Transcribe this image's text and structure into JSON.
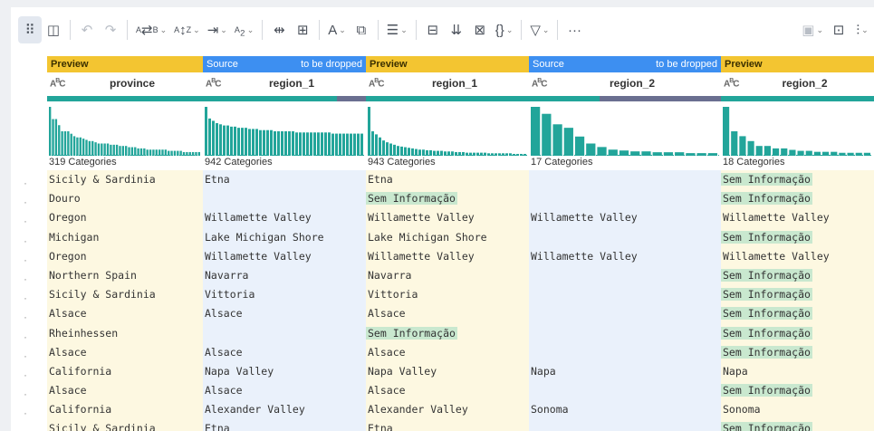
{
  "toolbar": {
    "items": [
      {
        "name": "grid-view-icon",
        "glyph": "⠿",
        "active": true
      },
      {
        "name": "column-view-icon",
        "glyph": "◫"
      },
      {
        "name": "undo-icon",
        "glyph": "↶",
        "dim": true
      },
      {
        "name": "redo-icon",
        "glyph": "↷",
        "dim": true
      }
    ]
  },
  "columns": [
    {
      "tag": "Preview",
      "tag_note": "",
      "tag_type": "preview",
      "type": "ABC",
      "name": "province",
      "categories": "319 Categories",
      "quality_missing": [],
      "histogram": [
        4,
        3,
        3,
        2.5,
        2,
        2,
        2,
        1.8,
        1.6,
        1.5,
        1.5,
        1.4,
        1.3,
        1.2,
        1.2,
        1.1,
        1,
        1,
        1,
        1,
        0.9,
        0.9,
        0.9,
        0.8,
        0.8,
        0.8,
        0.7,
        0.7,
        0.7,
        0.6,
        0.6,
        0.6,
        0.5,
        0.5,
        0.5,
        0.5,
        0.5,
        0.5,
        0.5,
        0.4,
        0.4,
        0.4,
        0.4,
        0.4,
        0.3,
        0.3,
        0.3,
        0.3,
        0.3,
        0.3
      ],
      "bg": "yellow",
      "cells": [
        {
          "v": "Sicily & Sardinia",
          "hl": false
        },
        {
          "v": "Douro",
          "hl": false
        },
        {
          "v": "Oregon",
          "hl": false
        },
        {
          "v": "Michigan",
          "hl": false
        },
        {
          "v": "Oregon",
          "hl": false
        },
        {
          "v": "Northern Spain",
          "hl": false
        },
        {
          "v": "Sicily & Sardinia",
          "hl": false
        },
        {
          "v": "Alsace",
          "hl": false
        },
        {
          "v": "Rheinhessen",
          "hl": false
        },
        {
          "v": "Alsace",
          "hl": false
        },
        {
          "v": "California",
          "hl": false
        },
        {
          "v": "Alsace",
          "hl": false
        },
        {
          "v": "California",
          "hl": false
        },
        {
          "v": "Sicily & Sardinia",
          "hl": false
        }
      ]
    },
    {
      "tag": "Source",
      "tag_note": "to be dropped",
      "tag_type": "source",
      "type": "ABC",
      "name": "region_1",
      "categories": "942 Categories",
      "quality_missing": [
        0.82,
        1.0
      ],
      "histogram": [
        42,
        32,
        30,
        28,
        27,
        26,
        26,
        25,
        25,
        24,
        24,
        24,
        23,
        23,
        23,
        22,
        22,
        22,
        22,
        21,
        21,
        21,
        21,
        21,
        21,
        20,
        20,
        20,
        20,
        20,
        20,
        20,
        20,
        20,
        20,
        19,
        19,
        19,
        19,
        19,
        19,
        19,
        19,
        19
      ],
      "bg": "blue",
      "cells": [
        {
          "v": "Etna",
          "hl": false
        },
        {
          "v": "",
          "hl": false
        },
        {
          "v": "Willamette Valley",
          "hl": false
        },
        {
          "v": "Lake Michigan Shore",
          "hl": false
        },
        {
          "v": "Willamette Valley",
          "hl": false
        },
        {
          "v": "Navarra",
          "hl": false
        },
        {
          "v": "Vittoria",
          "hl": false
        },
        {
          "v": "Alsace",
          "hl": false
        },
        {
          "v": "",
          "hl": false
        },
        {
          "v": "Alsace",
          "hl": false
        },
        {
          "v": "Napa Valley",
          "hl": false
        },
        {
          "v": "Alsace",
          "hl": false
        },
        {
          "v": "Alexander Valley",
          "hl": false
        },
        {
          "v": "Etna",
          "hl": false
        }
      ]
    },
    {
      "tag": "Preview",
      "tag_note": "",
      "tag_type": "preview",
      "type": "ABC",
      "name": "region_1",
      "categories": "943 Categories",
      "quality_missing": [],
      "histogram": [
        8,
        4,
        3.5,
        3,
        2.5,
        2.2,
        2,
        1.8,
        1.6,
        1.5,
        1.4,
        1.3,
        1.2,
        1.1,
        1,
        1,
        0.9,
        0.9,
        0.8,
        0.8,
        0.8,
        0.7,
        0.7,
        0.7,
        0.6,
        0.6,
        0.6,
        0.5,
        0.5,
        0.5,
        0.5,
        0.5,
        0.5,
        0.4,
        0.4,
        0.4,
        0.4,
        0.4,
        0.4,
        0.4,
        0.3,
        0.3,
        0.3,
        0.3
      ],
      "bg": "yellow",
      "cells": [
        {
          "v": "Etna",
          "hl": false
        },
        {
          "v": "Sem Informação",
          "hl": true
        },
        {
          "v": "Willamette Valley",
          "hl": false
        },
        {
          "v": "Lake Michigan Shore",
          "hl": false
        },
        {
          "v": "Willamette Valley",
          "hl": false
        },
        {
          "v": "Navarra",
          "hl": false
        },
        {
          "v": "Vittoria",
          "hl": false
        },
        {
          "v": "Alsace",
          "hl": false
        },
        {
          "v": "Sem Informação",
          "hl": true
        },
        {
          "v": "Alsace",
          "hl": false
        },
        {
          "v": "Napa Valley",
          "hl": false
        },
        {
          "v": "Alsace",
          "hl": false
        },
        {
          "v": "Alexander Valley",
          "hl": false
        },
        {
          "v": "Etna",
          "hl": false
        }
      ]
    },
    {
      "tag": "Source",
      "tag_note": "to be dropped",
      "tag_type": "source",
      "type": "ABC",
      "name": "region_2",
      "categories": "17 Categories",
      "quality_missing": [
        0.37,
        1.0
      ],
      "histogram": [
        56,
        48,
        36,
        32,
        22,
        14,
        10,
        7,
        6,
        5,
        5,
        4,
        4,
        4,
        3,
        3,
        3
      ],
      "bg": "blue",
      "cells": [
        {
          "v": "",
          "hl": false
        },
        {
          "v": "",
          "hl": false
        },
        {
          "v": "Willamette Valley",
          "hl": false
        },
        {
          "v": "",
          "hl": false
        },
        {
          "v": "Willamette Valley",
          "hl": false
        },
        {
          "v": "",
          "hl": false
        },
        {
          "v": "",
          "hl": false
        },
        {
          "v": "",
          "hl": false
        },
        {
          "v": "",
          "hl": false
        },
        {
          "v": "",
          "hl": false
        },
        {
          "v": "Napa",
          "hl": false
        },
        {
          "v": "",
          "hl": false
        },
        {
          "v": "Sonoma",
          "hl": false
        },
        {
          "v": "",
          "hl": false
        }
      ]
    },
    {
      "tag": "Preview",
      "tag_note": "",
      "tag_type": "preview",
      "type": "ABC",
      "name": "region_2",
      "categories": "18 Categories",
      "quality_missing": [],
      "histogram": [
        10,
        5,
        4,
        3,
        2,
        2,
        1.5,
        1.5,
        1.2,
        1,
        1,
        0.8,
        0.8,
        0.8,
        0.6,
        0.6,
        0.6,
        0.6
      ],
      "bg": "yellow",
      "cells": [
        {
          "v": "Sem Informação",
          "hl": true
        },
        {
          "v": "Sem Informação",
          "hl": true
        },
        {
          "v": "Willamette Valley",
          "hl": false
        },
        {
          "v": "Sem Informação",
          "hl": true
        },
        {
          "v": "Willamette Valley",
          "hl": false
        },
        {
          "v": "Sem Informação",
          "hl": true
        },
        {
          "v": "Sem Informação",
          "hl": true
        },
        {
          "v": "Sem Informação",
          "hl": true
        },
        {
          "v": "Sem Informação",
          "hl": true
        },
        {
          "v": "Sem Informação",
          "hl": true
        },
        {
          "v": "Napa",
          "hl": false
        },
        {
          "v": "Sem Informação",
          "hl": true
        },
        {
          "v": "Sonoma",
          "hl": false
        },
        {
          "v": "Sem Informação",
          "hl": true
        }
      ]
    }
  ],
  "row_marker": "·",
  "colors": {
    "accent": "#22a59a",
    "preview": "#f3c531",
    "source": "#3d8ff1",
    "highlight": "#c9e8cf",
    "missing": "#6a6f90"
  }
}
